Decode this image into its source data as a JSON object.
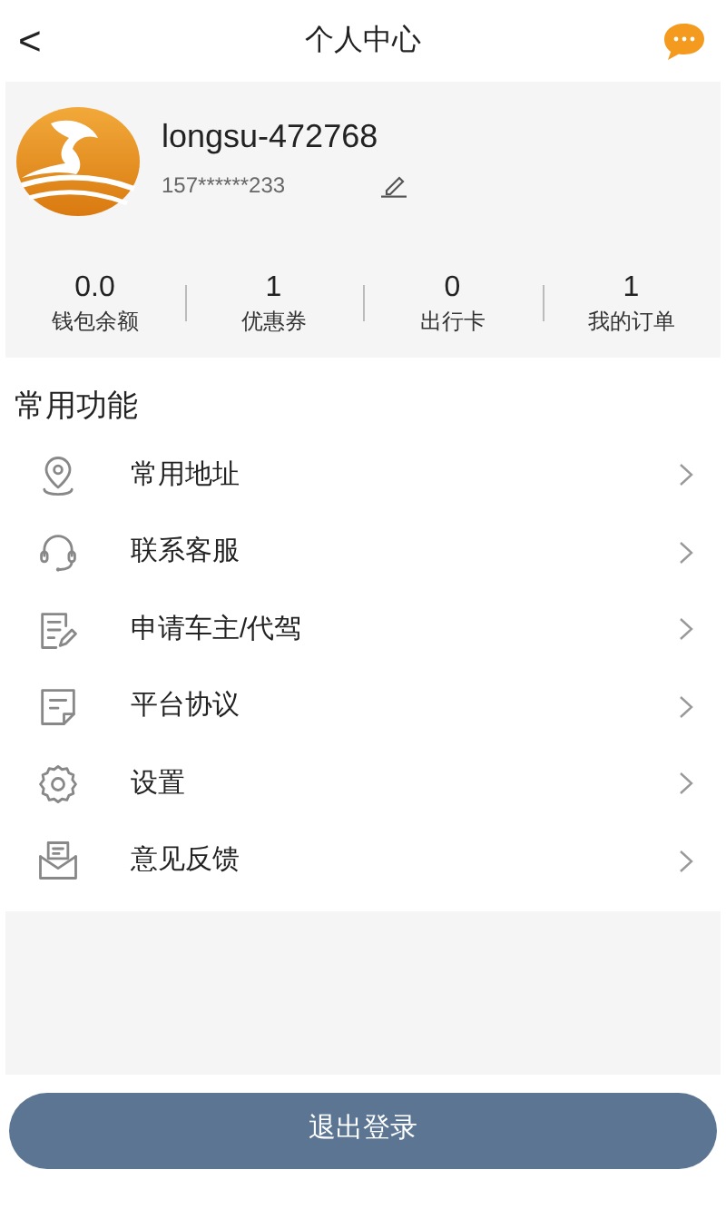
{
  "header": {
    "back": "<",
    "title": "个人中心"
  },
  "profile": {
    "username": "longsu-472768",
    "phone": "157******233"
  },
  "stats": [
    {
      "value": "0.0",
      "label": "钱包余额"
    },
    {
      "value": "1",
      "label": "优惠券"
    },
    {
      "value": "0",
      "label": "出行卡"
    },
    {
      "value": "1",
      "label": "我的订单"
    }
  ],
  "section_title": "常用功能",
  "menu": [
    {
      "kind": "location",
      "label": "常用地址"
    },
    {
      "kind": "headset",
      "label": "联系客服"
    },
    {
      "kind": "form",
      "label": "申请车主/代驾"
    },
    {
      "kind": "document",
      "label": "平台协议"
    },
    {
      "kind": "gear",
      "label": "设置"
    },
    {
      "kind": "mail",
      "label": "意见反馈"
    }
  ],
  "logout_button": "退出登录"
}
